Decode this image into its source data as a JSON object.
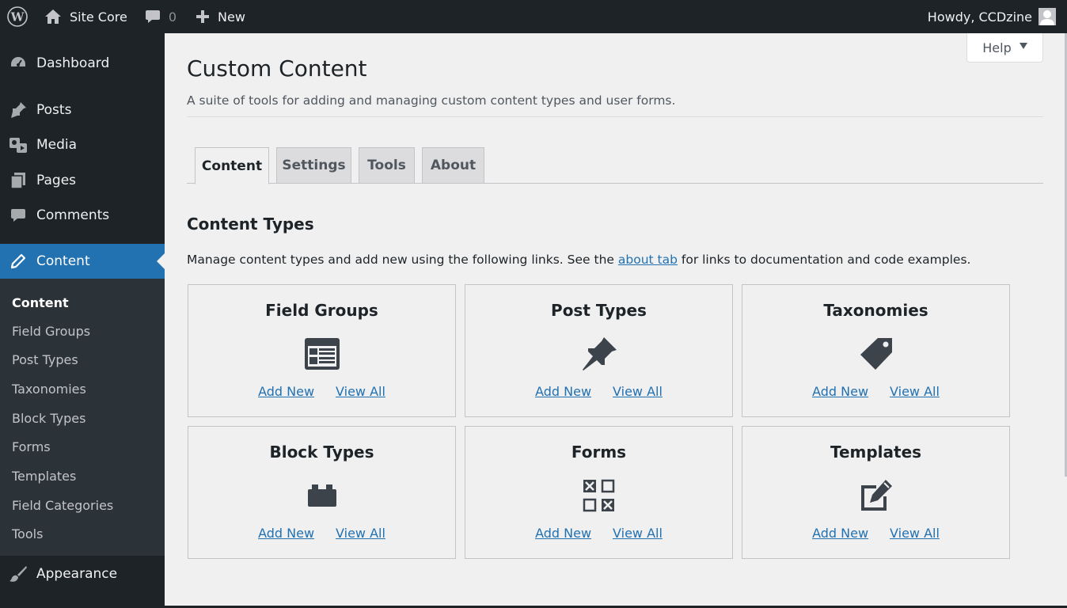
{
  "adminbar": {
    "site_name": "Site Core",
    "comments_count": "0",
    "new_label": "New",
    "howdy": "Howdy, CCDzine"
  },
  "sidebar": {
    "items": [
      {
        "label": "Dashboard",
        "icon": "dashboard-icon"
      },
      {
        "label": "Posts",
        "icon": "pushpin-icon"
      },
      {
        "label": "Media",
        "icon": "media-icon"
      },
      {
        "label": "Pages",
        "icon": "pages-icon"
      },
      {
        "label": "Comments",
        "icon": "comment-icon"
      },
      {
        "label": "Content",
        "icon": "pencil-icon"
      },
      {
        "label": "Appearance",
        "icon": "brush-icon"
      }
    ],
    "submenu": [
      "Content",
      "Field Groups",
      "Post Types",
      "Taxonomies",
      "Block Types",
      "Forms",
      "Templates",
      "Field Categories",
      "Tools"
    ]
  },
  "help": {
    "label": "Help"
  },
  "page": {
    "title": "Custom Content",
    "description": "A suite of tools for adding and managing custom content types and user forms."
  },
  "tabs": [
    "Content",
    "Settings",
    "Tools",
    "About"
  ],
  "section": {
    "title": "Content Types",
    "desc_before": "Manage content types and add new using the following links. See the ",
    "desc_link": "about tab",
    "desc_after": " for links to documentation and code examples."
  },
  "cards": [
    {
      "title": "Field Groups",
      "icon": "field-groups-icon",
      "add": "Add New",
      "view": "View All"
    },
    {
      "title": "Post Types",
      "icon": "pushpin-icon",
      "add": "Add New",
      "view": "View All"
    },
    {
      "title": "Taxonomies",
      "icon": "tag-icon",
      "add": "Add New",
      "view": "View All"
    },
    {
      "title": "Block Types",
      "icon": "block-icon",
      "add": "Add New",
      "view": "View All"
    },
    {
      "title": "Forms",
      "icon": "forms-icon",
      "add": "Add New",
      "view": "View All"
    },
    {
      "title": "Templates",
      "icon": "edit-page-icon",
      "add": "Add New",
      "view": "View All"
    }
  ],
  "colors": {
    "admin_bg": "#1d2327",
    "accent": "#2271b1",
    "page_bg": "#f0f0f1"
  }
}
